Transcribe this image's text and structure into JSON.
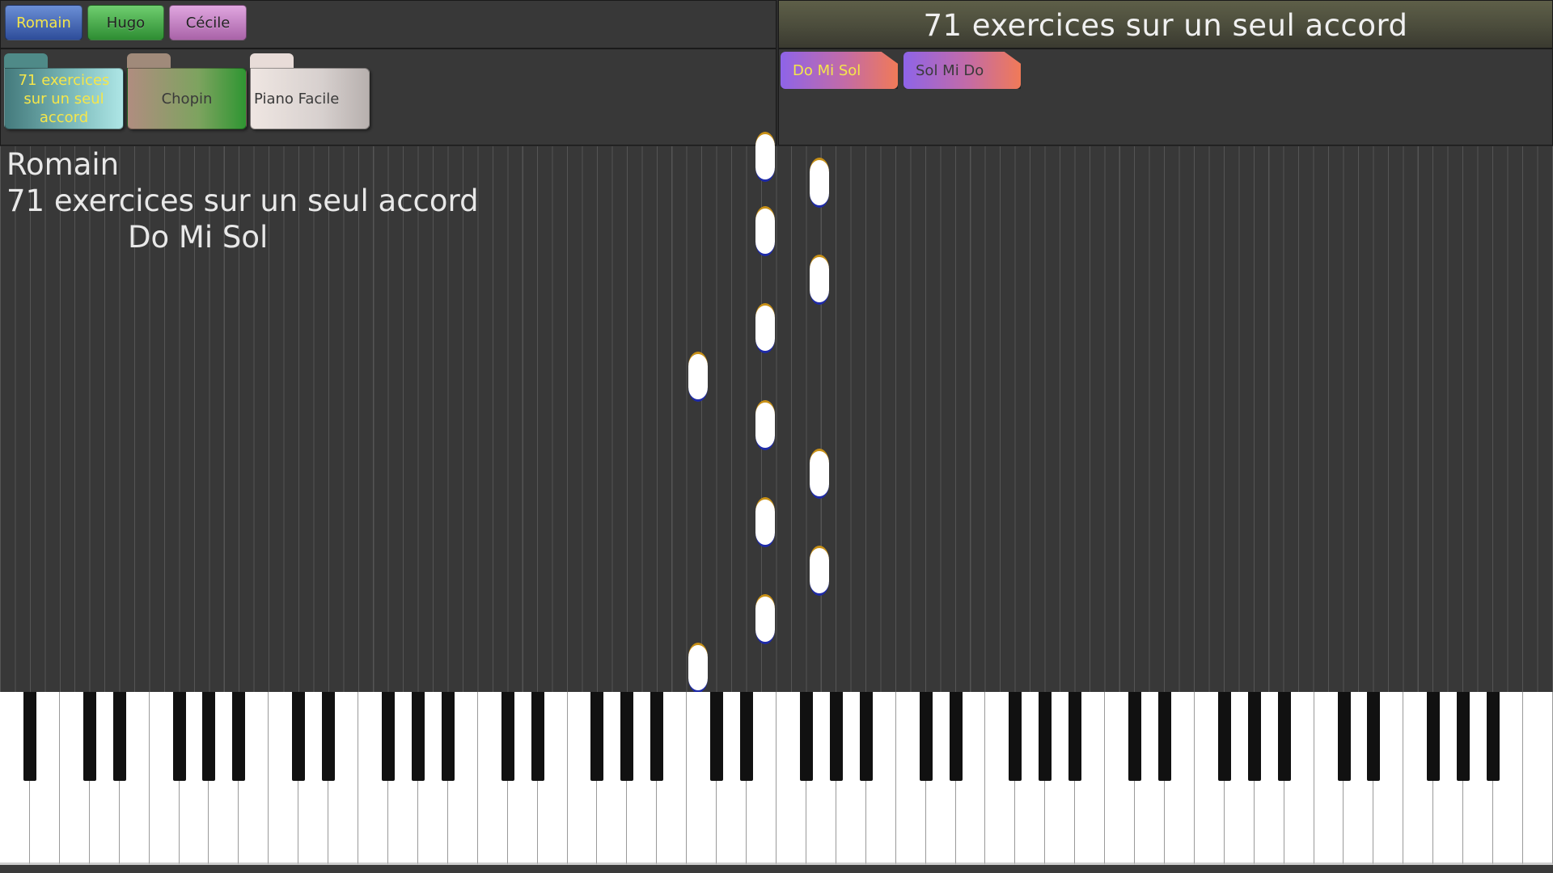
{
  "users": [
    {
      "name": "Romain",
      "selected": true,
      "color": "#2e4d9a"
    },
    {
      "name": "Hugo",
      "selected": false,
      "color": "#2e8d33"
    },
    {
      "name": "Cécile",
      "selected": false,
      "color": "#a963a8"
    }
  ],
  "header": {
    "title": "71 exercices sur un seul accord"
  },
  "folders": [
    {
      "label": "71 exercices sur un seul accord",
      "selected": true
    },
    {
      "label": "Chopin",
      "selected": false
    },
    {
      "label": "Piano Facile",
      "selected": false
    }
  ],
  "exercises": [
    {
      "label": "Do Mi Sol",
      "selected": true
    },
    {
      "label": "Sol Mi Do",
      "selected": false
    }
  ],
  "info": {
    "user": "Romain",
    "collection": "71 exercices sur un seul accord",
    "exercise": "Do Mi Sol"
  },
  "colors": {
    "accent_text": "#f5e64a",
    "note_fill": "#ffffff",
    "note_top": "#c89016",
    "note_bottom": "#1e2aa8",
    "background": "#383838"
  }
}
